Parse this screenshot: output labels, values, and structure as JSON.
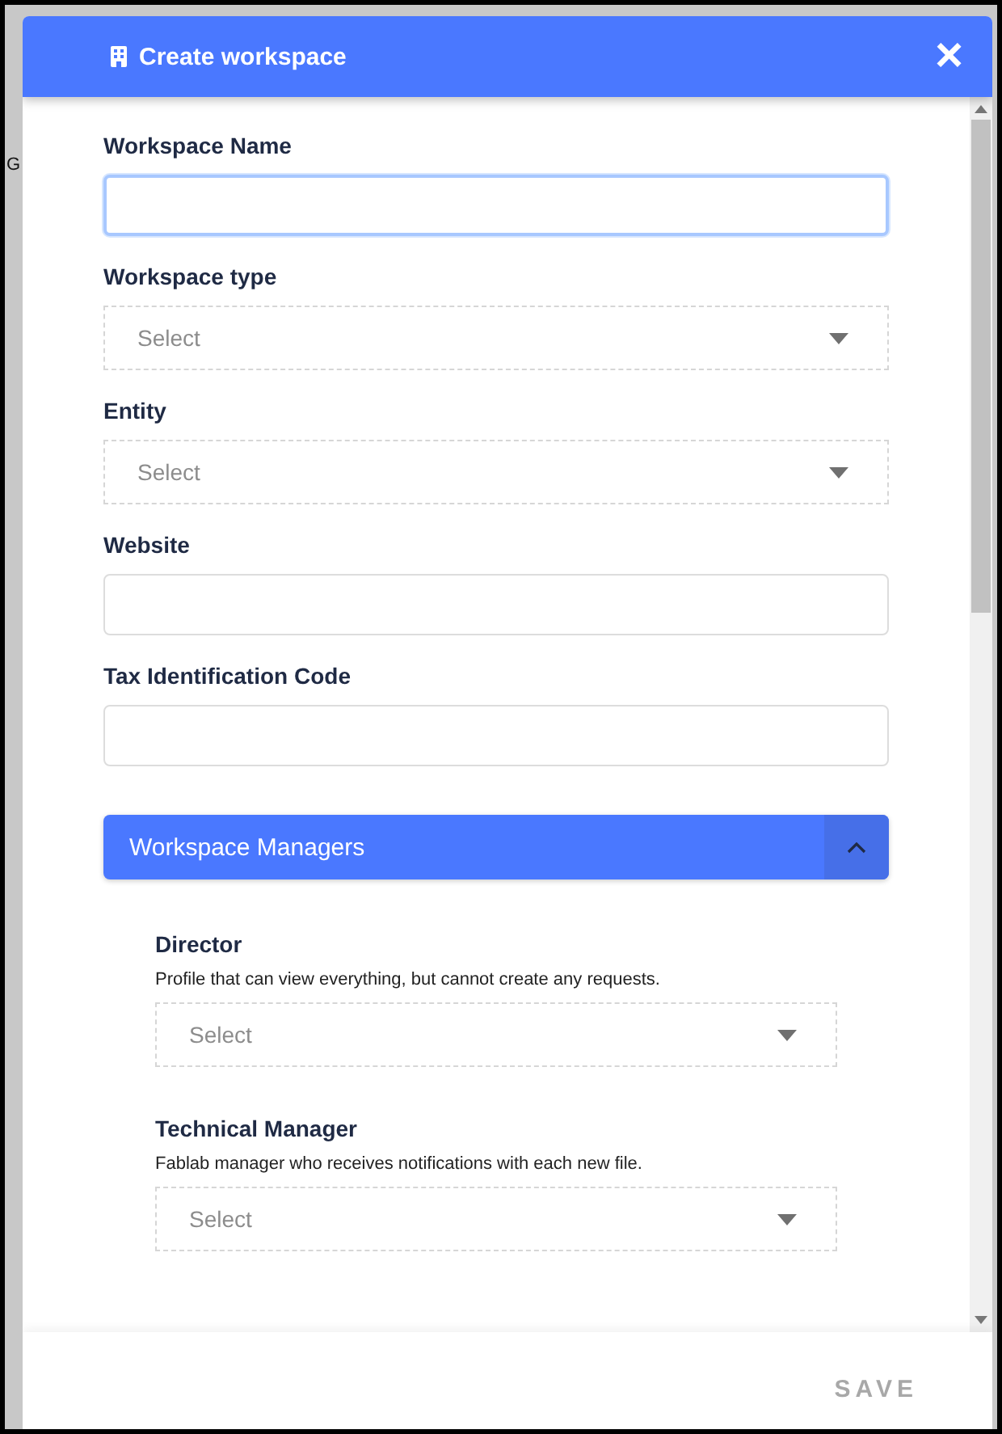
{
  "backdrop": {
    "text": "G"
  },
  "dialog": {
    "title": "Create workspace",
    "close": "×"
  },
  "fields": [
    {
      "kind": "text",
      "label": "Workspace Name",
      "focused": true
    },
    {
      "kind": "select",
      "label": "Workspace type",
      "placeholder": "Select"
    },
    {
      "kind": "select",
      "label": "Entity",
      "placeholder": "Select"
    },
    {
      "kind": "text",
      "label": "Website",
      "focused": false
    },
    {
      "kind": "text",
      "label": "Tax Identification Code",
      "focused": false
    }
  ],
  "section": {
    "title": "Workspace Managers",
    "expanded": true,
    "fields": [
      {
        "label": "Director",
        "description": "Profile that can view everything, but cannot create any requests.",
        "placeholder": "Select"
      },
      {
        "label": "Technical Manager",
        "description": "Fablab manager who receives notifications with each new file.",
        "placeholder": "Select"
      }
    ]
  },
  "footer": {
    "save": {
      "label": "SAVE",
      "disabled": true
    }
  }
}
